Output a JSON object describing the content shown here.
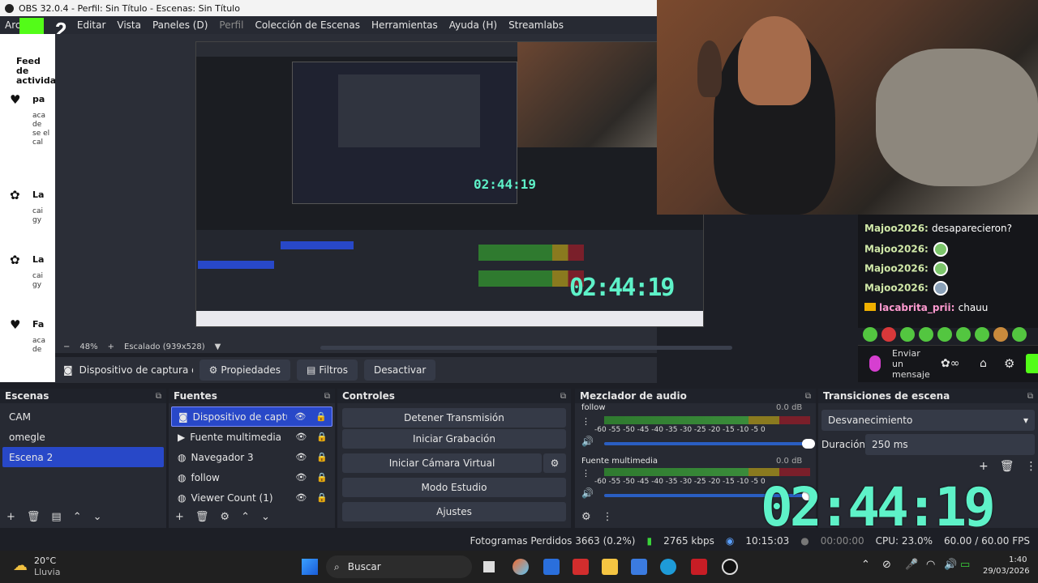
{
  "window": {
    "title": "OBS 32.0.4 - Perfil: Sin Título - Escenas: Sin Título"
  },
  "menu": [
    "Archivo",
    "Editar",
    "Vista",
    "Paneles (D)",
    "Perfil",
    "Colección de Escenas",
    "Herramientas",
    "Ayuda (H)",
    "Streamlabs"
  ],
  "kick_badge": "2",
  "feed": {
    "title": "Feed de actividad",
    "items": [
      {
        "icon": "heart-icon",
        "title": "pa",
        "sub": "aca de se el cal"
      },
      {
        "icon": "gift-icon",
        "title": "La",
        "sub": "cai gy",
        "green": "gy"
      },
      {
        "icon": "gift-icon",
        "title": "La",
        "sub": "cai gy",
        "green": "gy"
      },
      {
        "icon": "heart-icon",
        "title": "Fa",
        "sub": "aca de"
      }
    ]
  },
  "preview": {
    "zoom": "48%",
    "scaled": "Escalado (939x528)",
    "nested_timer": "02:44:19",
    "nested_timer_small": "02:44:19"
  },
  "chat": {
    "messages": [
      {
        "user": "Majoo2026:",
        "text": "desaparecieron?"
      },
      {
        "user": "Majoo2026:",
        "text": ""
      },
      {
        "user": "Majoo2026:",
        "text": ""
      },
      {
        "user": "Majoo2026:",
        "text": ""
      },
      {
        "user": "lacabrita_prii:",
        "text": "chauu"
      }
    ],
    "input_placeholder": "Enviar un mensaje"
  },
  "source_toolbar": {
    "source_name": "Dispositivo de captura de v",
    "properties": "Propiedades",
    "filters": "Filtros",
    "deactivate": "Desactivar"
  },
  "scenes": {
    "title": "Escenas",
    "items": [
      "CAM",
      "omegle",
      "Escena 2"
    ],
    "selected": "Escena 2"
  },
  "sources": {
    "title": "Fuentes",
    "items": [
      {
        "name": "Dispositivo de captura d",
        "icon": "camera-icon",
        "selected": true
      },
      {
        "name": "Fuente multimedia",
        "icon": "play-icon",
        "selected": false
      },
      {
        "name": "Navegador 3",
        "icon": "globe-icon",
        "selected": false
      },
      {
        "name": "follow",
        "icon": "globe-icon",
        "selected": false
      },
      {
        "name": "Viewer Count (1)",
        "icon": "globe-icon",
        "selected": false
      }
    ]
  },
  "controls": {
    "title": "Controles",
    "stop_stream": "Detener Transmisión",
    "start_recording": "Iniciar Grabación",
    "start_virtual_cam": "Iniciar Cámara Virtual",
    "studio_mode": "Modo Estudio",
    "settings": "Ajustes"
  },
  "mixer": {
    "title": "Mezclador de audio",
    "channels": [
      {
        "name": "follow",
        "db": "0.0 dB",
        "level": 1.0
      },
      {
        "name": "Fuente multimedia",
        "db": "0.0 dB",
        "level": 0.95
      }
    ],
    "scale": "-60  -55  -50  -45  -40  -35  -30  -25  -20  -15  -10  -5  0"
  },
  "transitions": {
    "title": "Transiciones de escena",
    "selected": "Desvanecimiento",
    "duration_label": "Duración",
    "duration_value": "250 ms"
  },
  "overlay_timer": "02:44:19",
  "status": {
    "dropped": "Fotogramas Perdidos 3663 (0.2%)",
    "bitrate": "2765 kbps",
    "stream_time": "10:15:03",
    "rec_time": "00:00:00",
    "cpu": "CPU: 23.0%",
    "fps": "60.00 / 60.00 FPS"
  },
  "taskbar": {
    "weather_temp": "20°C",
    "weather_desc": "Lluvia",
    "search_placeholder": "Buscar",
    "time": "1:40",
    "date": "29/03/2026"
  },
  "colors": {
    "accent": "#2848c8",
    "kick_green": "#53fc18",
    "timer": "#5ef2c8"
  }
}
